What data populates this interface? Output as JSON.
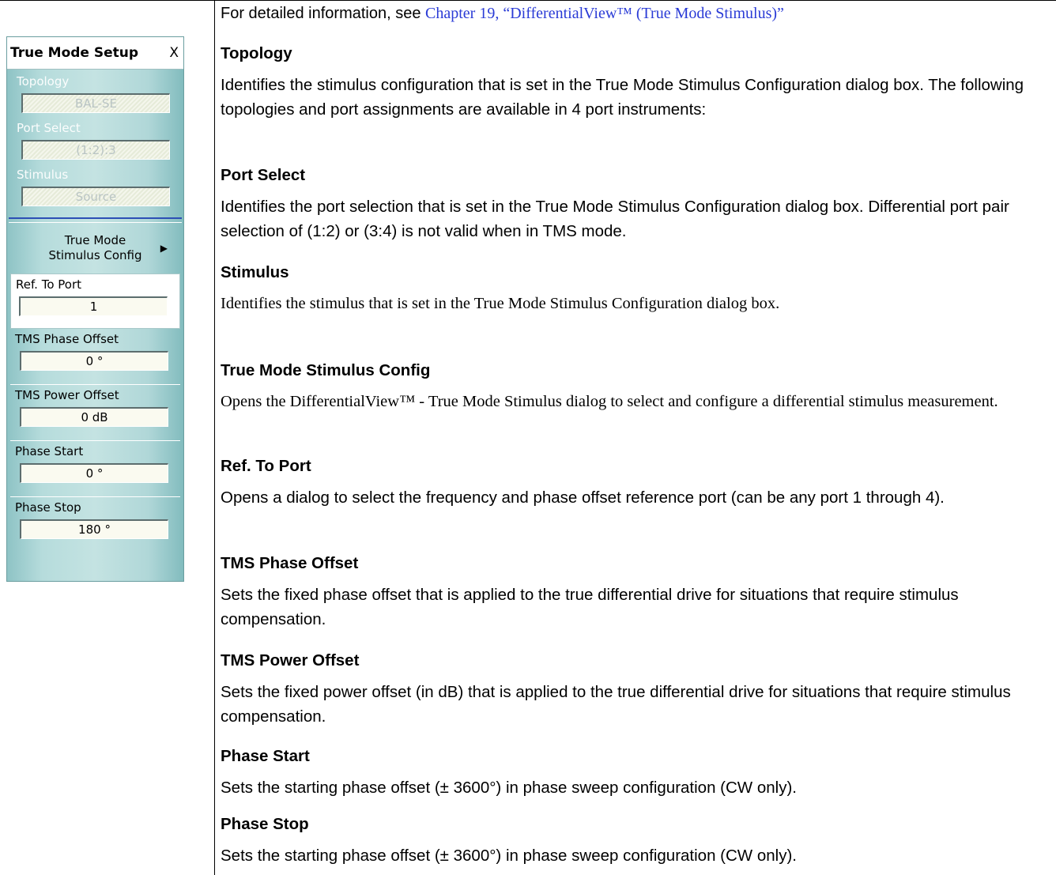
{
  "panel": {
    "title": "True Mode Setup",
    "close_label": "X",
    "topology": {
      "label": "Topology",
      "value": "BAL-SE"
    },
    "port_select": {
      "label": "Port Select",
      "value": "(1:2):3"
    },
    "stimulus": {
      "label": "Stimulus",
      "value": "Source"
    },
    "submenu": {
      "line1": "True Mode",
      "line2": "Stimulus Config",
      "arrow": "▶"
    },
    "ref_to_port": {
      "label": "Ref. To Port",
      "value": "1"
    },
    "tms_phase_offset": {
      "label": "TMS Phase Offset",
      "value": "0 °"
    },
    "tms_power_offset": {
      "label": "TMS Power Offset",
      "value": "0  dB"
    },
    "phase_start": {
      "label": "Phase Start",
      "value": "0 °"
    },
    "phase_stop": {
      "label": "Phase Stop",
      "value": "180 °"
    }
  },
  "doc": {
    "intro_text": "For detailed information, see ",
    "intro_link": "Chapter 19, “DifferentialView™ (True Mode Stimulus)”",
    "entries": [
      {
        "heading": "Topology",
        "body": "Identifies the stimulus configuration that is set in the True Mode Stimulus Configuration dialog box. The following topologies and port assignments are available in 4 port instruments:"
      },
      {
        "heading": "Port Select",
        "body": "Identifies the port selection that is set in the True Mode Stimulus Configuration dialog box. Differential port pair selection of (1:2) or (3:4) is not valid when in TMS mode."
      },
      {
        "heading": "Stimulus",
        "body": "Identifies the stimulus that is set in the True Mode Stimulus Configuration dialog box."
      },
      {
        "heading": "True Mode Stimulus Config",
        "body": "Opens the DifferentialView™ - True Mode Stimulus dialog to select and configure a differential stimulus measurement."
      },
      {
        "heading": "Ref. To Port",
        "body": "Opens a dialog to select the frequency and phase offset reference port (can be any port 1 through 4)."
      },
      {
        "heading": "TMS Phase Offset",
        "body": "Sets the fixed phase offset that is applied to the true differential drive for situations that require stimulus compensation."
      },
      {
        "heading": "TMS Power Offset",
        "body": "Sets the fixed power offset (in dB) that is applied to the true differential drive for situations that require stimulus compensation."
      },
      {
        "heading": "Phase Start",
        "body": "Sets the starting phase offset (± 3600°) in phase sweep configuration (CW only)."
      },
      {
        "heading": "Phase Stop",
        "body": "Sets the starting phase offset (± 3600°) in phase sweep configuration (CW only)."
      }
    ]
  }
}
